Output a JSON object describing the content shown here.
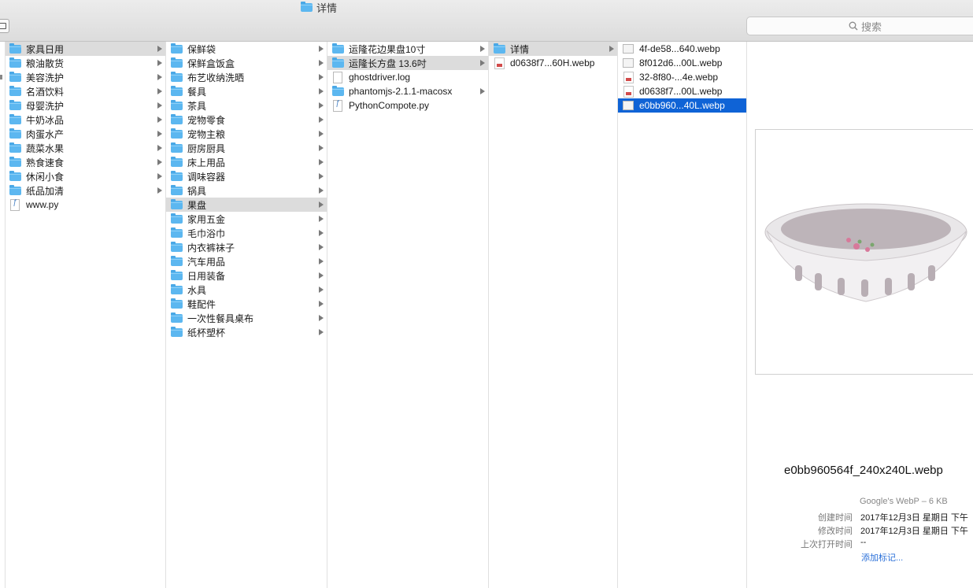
{
  "window": {
    "title": "详情"
  },
  "search": {
    "placeholder": "搜索"
  },
  "columns": [
    {
      "items": [
        {
          "label": "家具日用",
          "icon": "folder-icon",
          "state": "highlight",
          "arrow": true
        },
        {
          "label": "粮油散货",
          "icon": "folder-icon",
          "arrow": true
        },
        {
          "label": "美容洗护",
          "icon": "folder-icon",
          "arrow": true
        },
        {
          "label": "名酒饮料",
          "icon": "folder-icon",
          "arrow": true
        },
        {
          "label": "母婴洗护",
          "icon": "folder-icon",
          "arrow": true
        },
        {
          "label": "牛奶冰品",
          "icon": "folder-icon",
          "arrow": true
        },
        {
          "label": "肉蛋水产",
          "icon": "folder-icon",
          "arrow": true
        },
        {
          "label": "蔬菜水果",
          "icon": "folder-icon",
          "arrow": true
        },
        {
          "label": "熟食速食",
          "icon": "folder-icon",
          "arrow": true
        },
        {
          "label": "休闲小食",
          "icon": "folder-icon",
          "arrow": true
        },
        {
          "label": "纸品加清",
          "icon": "folder-icon",
          "arrow": true
        },
        {
          "label": "www.py",
          "icon": "python-file-icon",
          "arrow": false
        }
      ]
    },
    {
      "items": [
        {
          "label": "保鲜袋",
          "icon": "folder-icon",
          "arrow": true
        },
        {
          "label": "保鲜盒饭盒",
          "icon": "folder-icon",
          "arrow": true
        },
        {
          "label": "布艺收纳洗晒",
          "icon": "folder-icon",
          "arrow": true
        },
        {
          "label": "餐具",
          "icon": "folder-icon",
          "arrow": true
        },
        {
          "label": "茶具",
          "icon": "folder-icon",
          "arrow": true
        },
        {
          "label": "宠物零食",
          "icon": "folder-icon",
          "arrow": true
        },
        {
          "label": "宠物主粮",
          "icon": "folder-icon",
          "arrow": true
        },
        {
          "label": "厨房厨具",
          "icon": "folder-icon",
          "arrow": true
        },
        {
          "label": "床上用品",
          "icon": "folder-icon",
          "arrow": true
        },
        {
          "label": "调味容器",
          "icon": "folder-icon",
          "arrow": true
        },
        {
          "label": "锅具",
          "icon": "folder-icon",
          "arrow": true
        },
        {
          "label": "果盘",
          "icon": "folder-icon",
          "state": "highlight",
          "arrow": true
        },
        {
          "label": "家用五金",
          "icon": "folder-icon",
          "arrow": true
        },
        {
          "label": "毛巾浴巾",
          "icon": "folder-icon",
          "arrow": true
        },
        {
          "label": "内衣裤袜子",
          "icon": "folder-icon",
          "arrow": true
        },
        {
          "label": "汽车用品",
          "icon": "folder-icon",
          "arrow": true
        },
        {
          "label": "日用装备",
          "icon": "folder-icon",
          "arrow": true
        },
        {
          "label": "水具",
          "icon": "folder-icon",
          "arrow": true
        },
        {
          "label": "鞋配件",
          "icon": "folder-icon",
          "arrow": true
        },
        {
          "label": "一次性餐具桌布",
          "icon": "folder-icon",
          "arrow": true
        },
        {
          "label": "纸杯塑杯",
          "icon": "folder-icon",
          "arrow": true
        }
      ]
    },
    {
      "items": [
        {
          "label": "运隆花边果盘10寸",
          "icon": "folder-icon",
          "arrow": true
        },
        {
          "label": "运隆长方盘 13.6吋",
          "icon": "folder-icon",
          "state": "highlight",
          "arrow": true
        },
        {
          "label": "ghostdriver.log",
          "icon": "document-icon",
          "arrow": false
        },
        {
          "label": "phantomjs-2.1.1-macosx",
          "icon": "folder-icon",
          "arrow": true
        },
        {
          "label": "PythonCompote.py",
          "icon": "python-file-icon",
          "arrow": false
        }
      ]
    },
    {
      "items": [
        {
          "label": "详情",
          "icon": "folder-icon",
          "state": "highlight",
          "arrow": true
        },
        {
          "label": "d0638f7...60H.webp",
          "icon": "image-file-icon",
          "arrow": false
        }
      ]
    },
    {
      "items": [
        {
          "label": "4f-de58...640.webp",
          "icon": "image-plain-icon",
          "arrow": false
        },
        {
          "label": "8f012d6...00L.webp",
          "icon": "image-plain-icon",
          "arrow": false
        },
        {
          "label": "32-8f80-...4e.webp",
          "icon": "image-file-icon",
          "arrow": false
        },
        {
          "label": "d0638f7...00L.webp",
          "icon": "image-file-icon",
          "arrow": false
        },
        {
          "label": "e0bb960...40L.webp",
          "icon": "image-plain-icon",
          "state": "selected",
          "arrow": false
        }
      ]
    }
  ],
  "preview": {
    "filename": "e0bb960564f_240x240L.webp",
    "kind": "Google's WebP – 6 KB",
    "created_label": "创建时间",
    "created_value": "2017年12月3日 星期日 下午",
    "modified_label": "修改时间",
    "modified_value": "2017年12月3日 星期日 下午",
    "opened_label": "上次打开时间",
    "opened_value": "--",
    "add_tags": "添加标记..."
  },
  "colors": {
    "selection": "#0f63d6",
    "highlight": "#dcdcdc",
    "folder": "#5cb7f0",
    "link": "#2a6fd8"
  }
}
